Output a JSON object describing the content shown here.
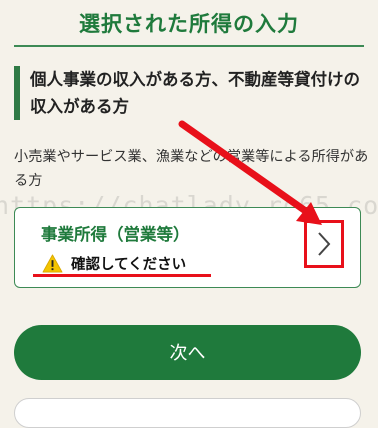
{
  "header": {
    "title": "選択された所得の入力"
  },
  "section": {
    "heading": "個人事業の収入がある方、不動産等貸付けの収入がある方",
    "description": "小売業やサービス業、漁業などの営業等による所得がある方"
  },
  "income_card": {
    "title": "事業所得（営業等）",
    "warning_text": "確認してください",
    "warning_icon": "warning-icon",
    "chevron_icon": "chevron-right-icon"
  },
  "watermark": "https://chatlady.ro65.com",
  "next_button": {
    "label": "次へ"
  },
  "colors": {
    "accent_green": "#1f7a3c",
    "annotation_red": "#e8101a",
    "warning_yellow": "#f3c400",
    "background": "#f5f2ea"
  }
}
